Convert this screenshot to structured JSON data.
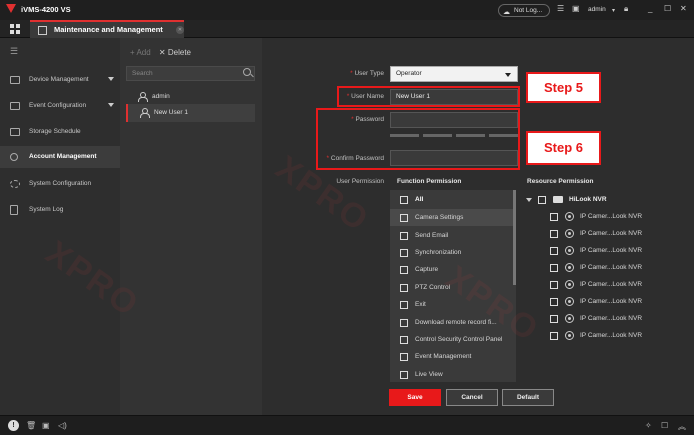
{
  "window": {
    "title": "iVMS-4200 VS",
    "cloud_status": "Not Log...",
    "user": "admin"
  },
  "tab": {
    "label": "Maintenance and Management"
  },
  "nav": {
    "items": [
      {
        "label": "Device Management",
        "icon": "device-icon",
        "has_arrow": true
      },
      {
        "label": "Event Configuration",
        "icon": "event-icon",
        "has_arrow": true
      },
      {
        "label": "Storage Schedule",
        "icon": "storage-icon",
        "has_arrow": false
      },
      {
        "label": "Account Management",
        "icon": "user-icon",
        "has_arrow": false,
        "active": true
      },
      {
        "label": "System Configuration",
        "icon": "gear-icon",
        "has_arrow": false
      },
      {
        "label": "System Log",
        "icon": "log-icon",
        "has_arrow": false
      }
    ]
  },
  "users": {
    "add_label": "Add",
    "delete_label": "Delete",
    "search_placeholder": "Search",
    "list": [
      {
        "name": "admin",
        "selected": false
      },
      {
        "name": "New User 1",
        "selected": true
      }
    ]
  },
  "form": {
    "user_type_label": "User Type",
    "user_type_value": "Operator",
    "user_name_label": "User Name",
    "user_name_value": "New User 1",
    "password_label": "Password",
    "confirm_label": "Confirm Password",
    "user_permission_label": "User Permission",
    "function_permission_label": "Function Permission",
    "resource_permission_label": "Resource Permission"
  },
  "steps": {
    "step5": "Step 5",
    "step6": "Step 6"
  },
  "function_permissions": [
    {
      "label": "All",
      "bold": true
    },
    {
      "label": "Camera Settings",
      "highlight": true
    },
    {
      "label": "Send Email"
    },
    {
      "label": "Synchronization"
    },
    {
      "label": "Capture"
    },
    {
      "label": "PTZ Control"
    },
    {
      "label": "Exit"
    },
    {
      "label": "Download remote record fi..."
    },
    {
      "label": "Control Security Control Panel"
    },
    {
      "label": "Event Management"
    },
    {
      "label": "Live View"
    }
  ],
  "resource_permissions": {
    "root": "HiLook NVR",
    "cameras": [
      "IP Camer...Look NVR",
      "IP Camer...Look NVR",
      "IP Camer...Look NVR",
      "IP Camer...Look NVR",
      "IP Camer...Look NVR",
      "IP Camer...Look NVR",
      "IP Camer...Look NVR",
      "IP Camer...Look NVR"
    ]
  },
  "buttons": {
    "save": "Save",
    "cancel": "Cancel",
    "default": "Default"
  },
  "colors": {
    "accent": "#e8191a",
    "background": "#2b2b2b"
  }
}
